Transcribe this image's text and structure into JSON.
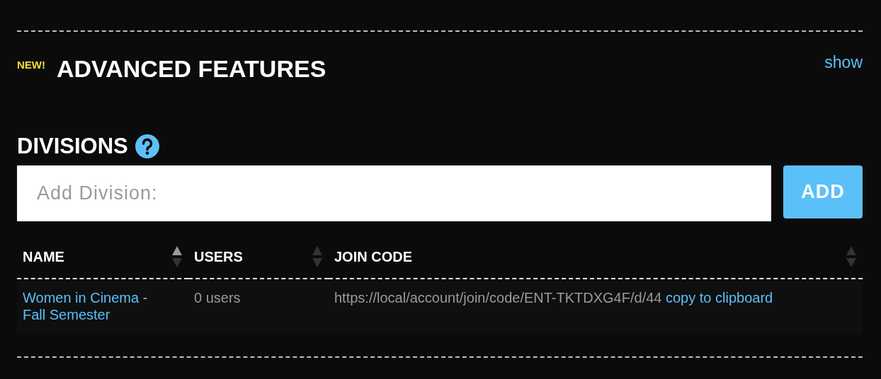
{
  "advanced": {
    "badge": "NEW!",
    "title": "ADVANCED FEATURES",
    "toggle": "show"
  },
  "divisions": {
    "title": "DIVISIONS",
    "add_field": {
      "placeholder": "Add Division:"
    },
    "add_button": "ADD",
    "table": {
      "columns": [
        {
          "label": "NAME",
          "sorted": true
        },
        {
          "label": "USERS",
          "sorted": false
        },
        {
          "label": "JOIN CODE",
          "sorted": false
        }
      ],
      "rows": [
        {
          "name": "Women in Cinema - Fall Semester",
          "users": "0 users",
          "join_code": "https://local/account/join/code/ENT-TKTDXG4F/d/44",
          "copy": "copy to clipboard"
        }
      ]
    }
  }
}
